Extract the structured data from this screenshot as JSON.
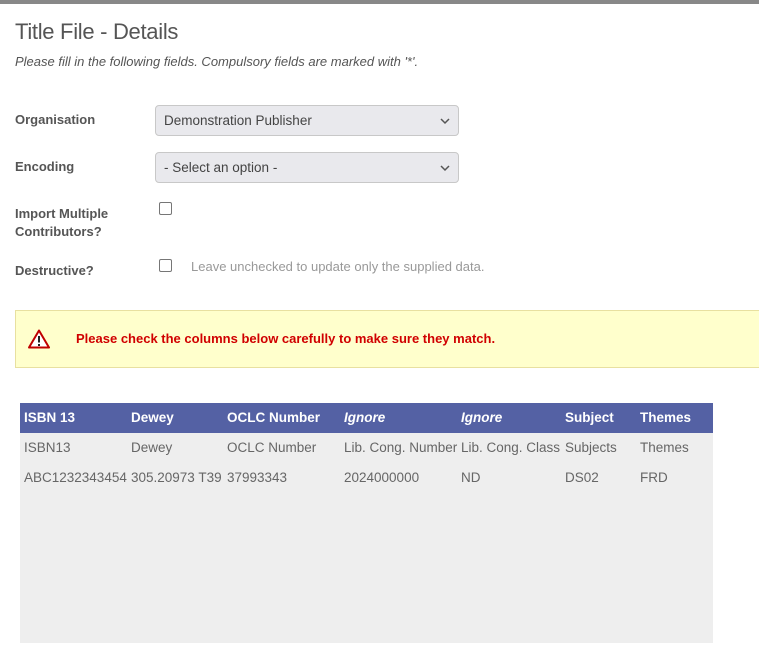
{
  "header": {
    "title": "Title File - Details",
    "subtitle": "Please fill in the following fields. Compulsory fields are marked with '*'."
  },
  "form": {
    "organisation": {
      "label": "Organisation",
      "value": "Demonstration Publisher"
    },
    "encoding": {
      "label": "Encoding",
      "value": "- Select an option -"
    },
    "import_multiple": {
      "label_line1": "Import Multiple",
      "label_line2": "Contributors?",
      "checked": false
    },
    "destructive": {
      "label": "Destructive?",
      "checked": false,
      "hint": "Leave unchecked to update only the supplied data."
    }
  },
  "alert": {
    "icon": "warning-triangle-icon",
    "message": "Please check the columns below carefully to make sure they match.",
    "color": "#d00000"
  },
  "table": {
    "header_color": "#5461a4",
    "columns": [
      {
        "label": "ISBN 13",
        "ignore": false
      },
      {
        "label": "Dewey",
        "ignore": false
      },
      {
        "label": "OCLC Number",
        "ignore": false
      },
      {
        "label": "Ignore",
        "ignore": true
      },
      {
        "label": "Ignore",
        "ignore": true
      },
      {
        "label": "Subject",
        "ignore": false
      },
      {
        "label": "Themes",
        "ignore": false
      }
    ],
    "rows": [
      [
        "ISBN13",
        "Dewey",
        "OCLC Number",
        "Lib. Cong. Number",
        "Lib. Cong. Class",
        "Subjects",
        "Themes"
      ],
      [
        "ABC1232343454",
        "305.20973 T39",
        "37993343",
        "2024000000",
        "ND",
        "DS02",
        "FRD"
      ]
    ]
  }
}
